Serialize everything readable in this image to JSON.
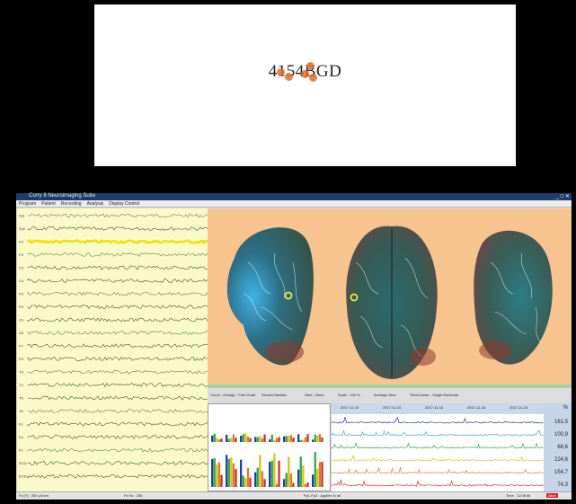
{
  "stimulus": {
    "text": "4154BGD"
  },
  "app": {
    "title": "Curry 8 Neuroimaging Suite",
    "menu": [
      "Program",
      "Patient",
      "Recording",
      "Analysis",
      "Display Control"
    ],
    "channels": [
      "Fp1",
      "Fp2",
      "F3",
      "F4",
      "C3",
      "C4",
      "P3",
      "P4",
      "O1",
      "O2",
      "F7",
      "F8",
      "T3",
      "T4",
      "T5",
      "T6",
      "Fz",
      "Cz",
      "Pz",
      "ECG",
      "EOG"
    ],
    "control_bar": {
      "items": [
        "Curve - Orange - Free Chart",
        "Second Median",
        "Start - None",
        "Scale : 100 %",
        "Average View",
        "TimeCourse - Single Electrode"
      ]
    },
    "timecourse": {
      "dates": [
        "2017-11-10",
        "2017-11-10",
        "2017-11-10",
        "2017-11-10",
        "2017-11-10"
      ],
      "series_colors": [
        "#1f3fa8",
        "#3aa8e0",
        "#2fa84a",
        "#d6c21a",
        "#e07a2a",
        "#c8332a"
      ]
    },
    "scale_unit": "%",
    "scale_values": [
      "161,5",
      "100,9",
      "68,6",
      "224,6",
      "154,7",
      "74,3"
    ],
    "status": {
      "left": "Fz  [Y] : 200 µV/cm",
      "mid": "Fz  Hz : 256",
      "file": "Fp1-Fp2 : Applies to all",
      "time": "Time :  11:08:46",
      "right": "Alive"
    },
    "bar_labels": [
      "F3",
      "F4",
      "C3",
      "C4",
      "P3",
      "P4",
      "T5",
      "T6"
    ],
    "colors": {
      "title": "#1f3b6a",
      "eeg_bg": "#fafac8",
      "brain_bg": "#f7c48f",
      "highlight_trace": "#f0e000"
    }
  }
}
